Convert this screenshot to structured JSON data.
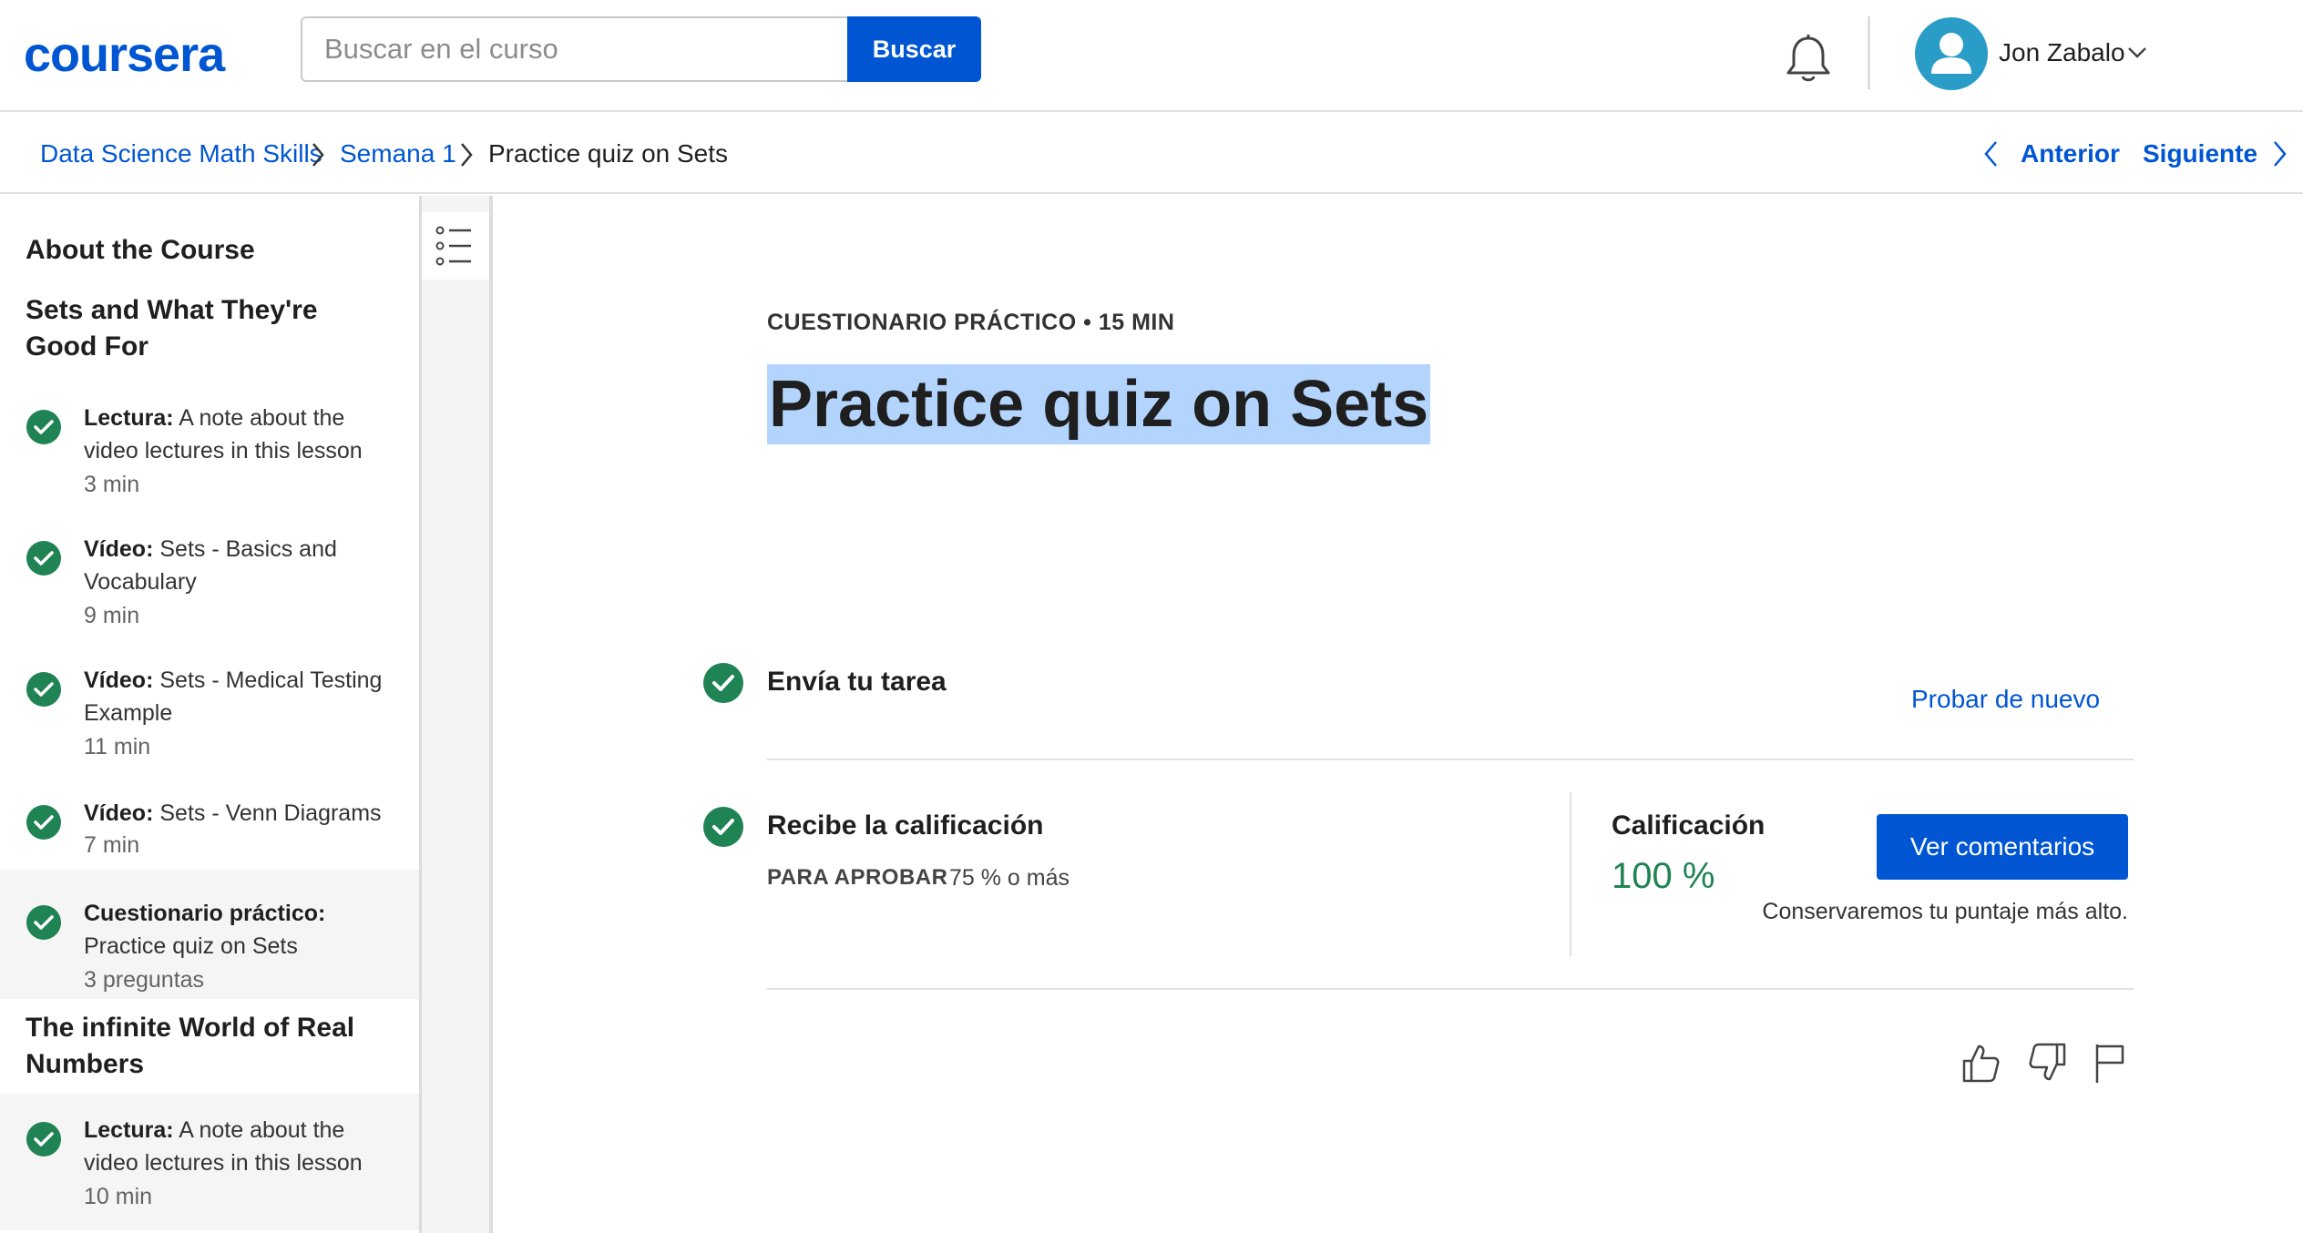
{
  "header": {
    "logo_text": "coursera",
    "search": {
      "placeholder": "Buscar en el curso",
      "button_label": "Buscar"
    },
    "user": {
      "name": "Jon Zabalo"
    },
    "icons": {
      "notifications": "bell-icon",
      "avatar": "user-avatar-icon",
      "menu": "chevron-down-icon"
    }
  },
  "breadcrumb": {
    "items": [
      "Data Science Math Skills",
      "Semana 1",
      "Practice quiz on Sets"
    ],
    "prev_label": "Anterior",
    "next_label": "Siguiente"
  },
  "sidebar": {
    "sections": [
      {
        "title": "About the Course",
        "items": []
      },
      {
        "title": "Sets and What They're Good For",
        "items": [
          {
            "kind": "Lectura:",
            "title": "A note about the video lectures in this lesson",
            "duration": "3 min",
            "completed": true,
            "active": false
          },
          {
            "kind": "Vídeo:",
            "title": "Sets - Basics and Vocabulary",
            "duration": "9 min",
            "completed": true,
            "active": false
          },
          {
            "kind": "Vídeo:",
            "title": "Sets - Medical Testing Example",
            "duration": "11 min",
            "completed": true,
            "active": false
          },
          {
            "kind": "Vídeo:",
            "title": "Sets - Venn Diagrams",
            "duration": "7 min",
            "completed": true,
            "active": false
          },
          {
            "kind": "Cuestionario práctico:",
            "title": "Practice quiz on Sets",
            "duration": "3 preguntas",
            "completed": true,
            "active": true
          }
        ]
      },
      {
        "title": "The infinite World of Real Numbers",
        "items": [
          {
            "kind": "Lectura:",
            "title": "A note about the video lectures in this lesson",
            "duration": "10 min",
            "completed": true,
            "active": false
          }
        ]
      }
    ]
  },
  "main": {
    "kicker": "CUESTIONARIO PRÁCTICO • 15 MIN",
    "title": "Practice quiz on Sets",
    "submit": {
      "label": "Envía tu tarea",
      "retry_label": "Probar de nuevo"
    },
    "grade": {
      "label": "Recibe la calificación",
      "pass_label": "PARA APROBAR",
      "pass_value": "75 % o más",
      "grade_label": "Calificación",
      "grade_value": "100 %",
      "feedback_button": "Ver comentarios",
      "keep_note": "Conservaremos tu puntaje más alto."
    },
    "feedback_icons": [
      "thumbs-up-icon",
      "thumbs-down-icon",
      "flag-icon"
    ]
  },
  "colors": {
    "brand": "#0056d2",
    "success": "#1f8354",
    "selection_highlight": "#b3d4fc",
    "avatar_bg": "#2a9cc8"
  }
}
